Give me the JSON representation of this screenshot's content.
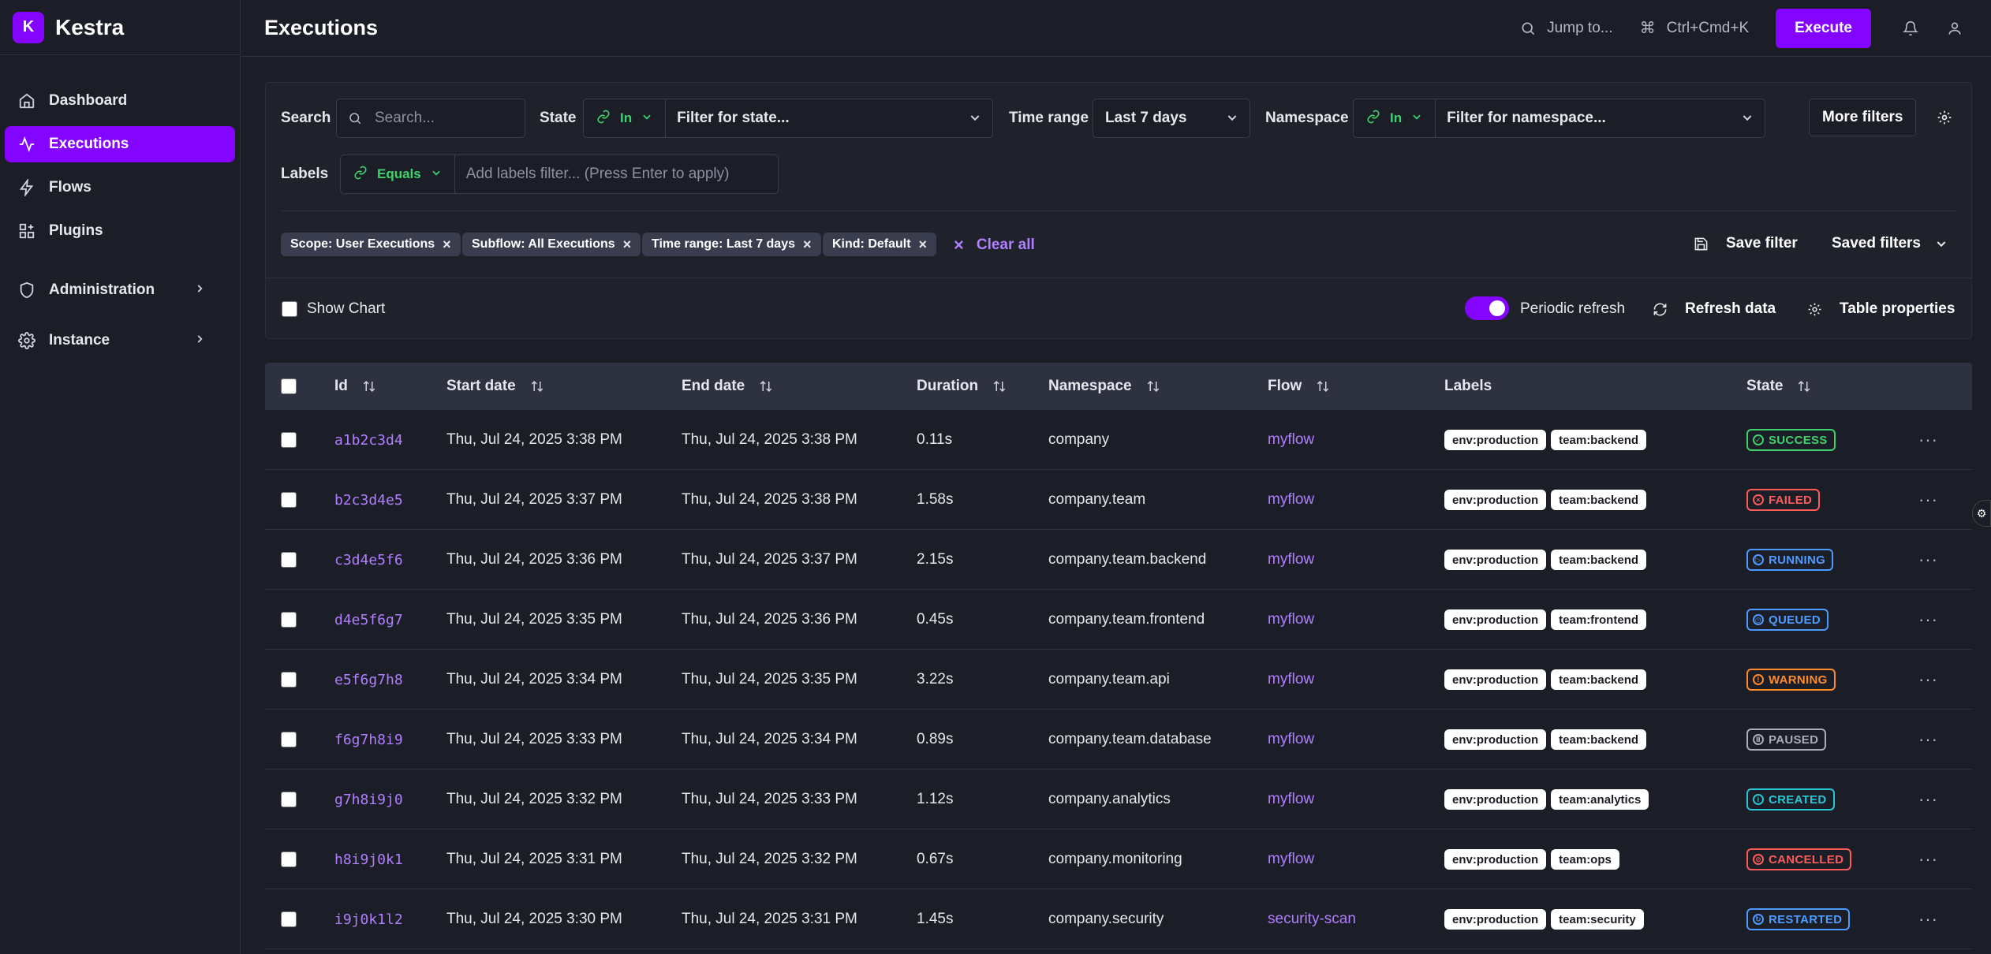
{
  "app": {
    "logo_letter": "K",
    "name": "Kestra"
  },
  "sidebar": {
    "items": [
      {
        "label": "Dashboard",
        "icon": "home-icon"
      },
      {
        "label": "Executions",
        "icon": "activity-icon",
        "active": true
      },
      {
        "label": "Flows",
        "icon": "lightning-icon"
      },
      {
        "label": "Plugins",
        "icon": "grid-plus-icon"
      },
      {
        "label": "Administration",
        "icon": "shield-icon"
      },
      {
        "label": "Instance",
        "icon": "gear-icon"
      }
    ]
  },
  "header": {
    "title": "Executions",
    "jump_label": "Jump to...",
    "shortcut_label": "Ctrl+Cmd+K",
    "execute_label": "Execute"
  },
  "filters": {
    "search_label": "Search",
    "search_placeholder": "Search...",
    "state_label": "State",
    "state_operator": "In",
    "state_placeholder": "Filter for state...",
    "time_range_label": "Time range",
    "time_range_value": "Last 7 days",
    "namespace_label": "Namespace",
    "namespace_operator": "In",
    "namespace_placeholder": "Filter for namespace...",
    "more_filters_label": "More filters",
    "labels_label": "Labels",
    "labels_operator": "Equals",
    "labels_placeholder": "Add labels filter... (Press Enter to apply)",
    "chips": [
      "Scope: User Executions",
      "Subflow: All Executions",
      "Time range: Last 7 days",
      "Kind: Default"
    ],
    "clear_all_label": "Clear all",
    "save_filter_label": "Save filter",
    "saved_filters_label": "Saved filters",
    "show_chart_label": "Show Chart",
    "periodic_refresh_label": "Periodic refresh",
    "refresh_data_label": "Refresh data",
    "table_properties_label": "Table properties"
  },
  "table": {
    "columns": [
      "Id",
      "Start date",
      "End date",
      "Duration",
      "Namespace",
      "Flow",
      "Labels",
      "State"
    ],
    "rows": [
      {
        "id": "a1b2c3d4",
        "start": "Thu, Jul 24, 2025 3:38 PM",
        "end": "Thu, Jul 24, 2025 3:38 PM",
        "duration": "0.11s",
        "namespace": "company",
        "flow": "myflow",
        "labels": [
          "env:production",
          "team:backend"
        ],
        "state": "SUCCESS"
      },
      {
        "id": "b2c3d4e5",
        "start": "Thu, Jul 24, 2025 3:37 PM",
        "end": "Thu, Jul 24, 2025 3:38 PM",
        "duration": "1.58s",
        "namespace": "company.team",
        "flow": "myflow",
        "labels": [
          "env:production",
          "team:backend"
        ],
        "state": "FAILED"
      },
      {
        "id": "c3d4e5f6",
        "start": "Thu, Jul 24, 2025 3:36 PM",
        "end": "Thu, Jul 24, 2025 3:37 PM",
        "duration": "2.15s",
        "namespace": "company.team.backend",
        "flow": "myflow",
        "labels": [
          "env:production",
          "team:backend"
        ],
        "state": "RUNNING"
      },
      {
        "id": "d4e5f6g7",
        "start": "Thu, Jul 24, 2025 3:35 PM",
        "end": "Thu, Jul 24, 2025 3:36 PM",
        "duration": "0.45s",
        "namespace": "company.team.frontend",
        "flow": "myflow",
        "labels": [
          "env:production",
          "team:frontend"
        ],
        "state": "QUEUED"
      },
      {
        "id": "e5f6g7h8",
        "start": "Thu, Jul 24, 2025 3:34 PM",
        "end": "Thu, Jul 24, 2025 3:35 PM",
        "duration": "3.22s",
        "namespace": "company.team.api",
        "flow": "myflow",
        "labels": [
          "env:production",
          "team:backend"
        ],
        "state": "WARNING"
      },
      {
        "id": "f6g7h8i9",
        "start": "Thu, Jul 24, 2025 3:33 PM",
        "end": "Thu, Jul 24, 2025 3:34 PM",
        "duration": "0.89s",
        "namespace": "company.team.database",
        "flow": "myflow",
        "labels": [
          "env:production",
          "team:backend"
        ],
        "state": "PAUSED"
      },
      {
        "id": "g7h8i9j0",
        "start": "Thu, Jul 24, 2025 3:32 PM",
        "end": "Thu, Jul 24, 2025 3:33 PM",
        "duration": "1.12s",
        "namespace": "company.analytics",
        "flow": "myflow",
        "labels": [
          "env:production",
          "team:analytics"
        ],
        "state": "CREATED"
      },
      {
        "id": "h8i9j0k1",
        "start": "Thu, Jul 24, 2025 3:31 PM",
        "end": "Thu, Jul 24, 2025 3:32 PM",
        "duration": "0.67s",
        "namespace": "company.monitoring",
        "flow": "myflow",
        "labels": [
          "env:production",
          "team:ops"
        ],
        "state": "CANCELLED"
      },
      {
        "id": "i9j0k1l2",
        "start": "Thu, Jul 24, 2025 3:30 PM",
        "end": "Thu, Jul 24, 2025 3:31 PM",
        "duration": "1.45s",
        "namespace": "company.security",
        "flow": "security-scan",
        "labels": [
          "env:production",
          "team:security"
        ],
        "state": "RESTARTED"
      }
    ]
  },
  "state_styles": {
    "SUCCESS": {
      "color": "#3fd16b",
      "icon": "check-circle-icon",
      "glyph": "✓"
    },
    "FAILED": {
      "color": "#ff5b5b",
      "icon": "x-circle-icon",
      "glyph": "×"
    },
    "RUNNING": {
      "color": "#4d9bff",
      "icon": "play-icon",
      "glyph": "▷"
    },
    "QUEUED": {
      "color": "#4d9bff",
      "icon": "clock-icon",
      "glyph": "◷"
    },
    "WARNING": {
      "color": "#ff8a2b",
      "icon": "warning-triangle-icon",
      "glyph": "!"
    },
    "PAUSED": {
      "color": "#a9acba",
      "icon": "pause-icon",
      "glyph": "Ⅱ"
    },
    "CREATED": {
      "color": "#29c6d6",
      "icon": "info-circle-icon",
      "glyph": "i"
    },
    "CANCELLED": {
      "color": "#ff5b5b",
      "icon": "ban-icon",
      "glyph": "⊘"
    },
    "RESTARTED": {
      "color": "#4d9bff",
      "icon": "restart-icon",
      "glyph": "↻"
    }
  }
}
